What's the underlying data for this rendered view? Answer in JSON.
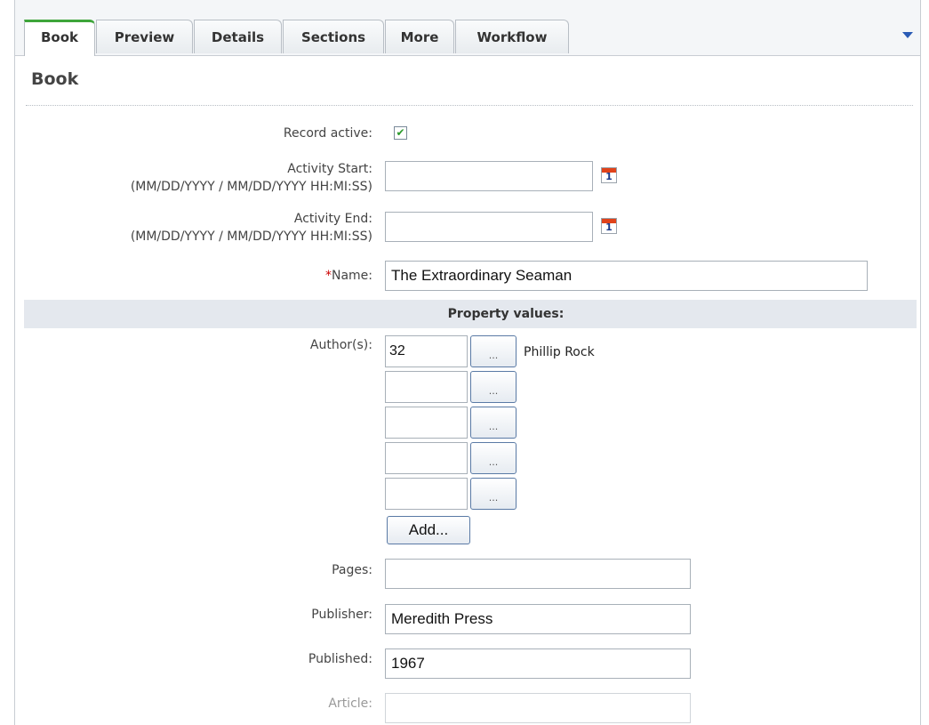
{
  "tabs": [
    {
      "label": "Book",
      "active": true
    },
    {
      "label": "Preview"
    },
    {
      "label": "Details"
    },
    {
      "label": "Sections"
    },
    {
      "label": "More"
    },
    {
      "label": "Workflow"
    }
  ],
  "header": {
    "title": "Book"
  },
  "form": {
    "record_active_label": "Record active:",
    "record_active_checked": true,
    "activity_start_label": "Activity Start:",
    "activity_start_hint": "(MM/DD/YYYY / MM/DD/YYYY HH:MI:SS)",
    "activity_start_value": "",
    "activity_end_label": "Activity End:",
    "activity_end_hint": "(MM/DD/YYYY / MM/DD/YYYY HH:MI:SS)",
    "activity_end_value": "",
    "calendar_icon_text": "1",
    "name_required_mark": "*",
    "name_label": "Name:",
    "name_value": "The Extraordinary Seaman"
  },
  "properties": {
    "section_title": "Property values:",
    "authors_label": "Author(s):",
    "authors": [
      {
        "id": "32",
        "name": "Phillip Rock"
      },
      {
        "id": "",
        "name": ""
      },
      {
        "id": "",
        "name": ""
      },
      {
        "id": "",
        "name": ""
      },
      {
        "id": "",
        "name": ""
      }
    ],
    "lookup_button_label": "...",
    "add_button_label": "Add...",
    "pages_label": "Pages:",
    "pages_value": "",
    "publisher_label": "Publisher:",
    "publisher_value": "Meredith Press",
    "published_label": "Published:",
    "published_value": "1967",
    "article_label": "Article:",
    "article_value": ""
  },
  "colors": {
    "active_tab_accent": "#3ea53a",
    "required_mark": "#cc0000",
    "section_bar": "#e4e8ee",
    "dropdown_arrow": "#2a5bb5"
  },
  "icons": {
    "checkbox": "check-icon",
    "calendar": "calendar-icon",
    "tab_menu": "chevron-down-icon"
  }
}
